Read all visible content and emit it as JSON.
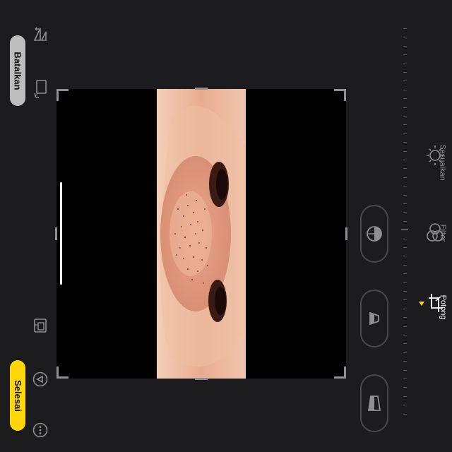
{
  "toolbar": {
    "cancel_label": "Batalkan",
    "done_label": "Selesai"
  },
  "tabs": [
    {
      "label": "Potong",
      "icon": "crop-icon",
      "active": true
    },
    {
      "label": "Filter",
      "icon": "filter-icon",
      "active": false
    },
    {
      "label": "Sesuaikan",
      "icon": "adjust-icon",
      "active": false
    }
  ],
  "perspective": [
    {
      "icon": "straighten-icon"
    },
    {
      "icon": "vertical-perspective-icon"
    },
    {
      "icon": "horizontal-perspective-icon"
    }
  ],
  "icons": {
    "flip": "flip-icon",
    "rotate": "rotate-icon",
    "aspect": "aspect-ratio-icon",
    "markup": "markup-icon",
    "more": "more-icon"
  },
  "colors": {
    "background": "#1c1c1e",
    "accent": "#ffd60a",
    "cancel_pill": "#bdbdbd",
    "crop_background": "#000000",
    "tab_inactive": "#8e8e93"
  }
}
